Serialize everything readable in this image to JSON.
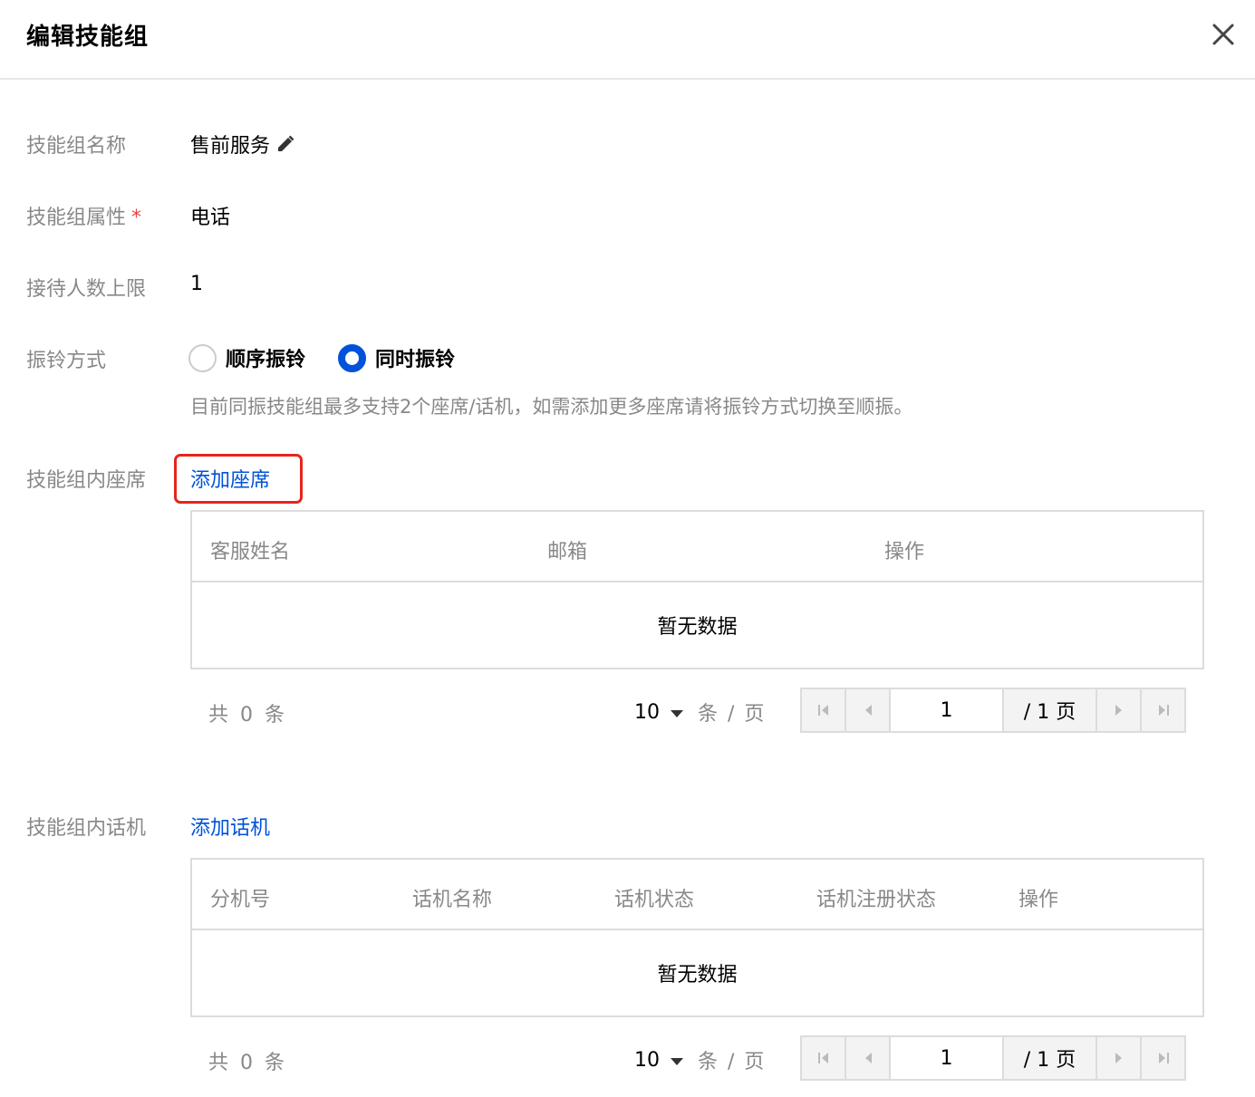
{
  "dialog": {
    "title": "编辑技能组"
  },
  "form": {
    "name_label": "技能组名称",
    "name_value": "售前服务",
    "attr_label": "技能组属性",
    "required_mark": "*",
    "attr_value": "电话",
    "limit_label": "接待人数上限",
    "limit_value": "1",
    "ring_label": "振铃方式",
    "ring_options": [
      {
        "label": "顺序振铃",
        "checked": false
      },
      {
        "label": "同时振铃",
        "checked": true
      }
    ],
    "ring_hint": "目前同振技能组最多支持2个座席/话机，如需添加更多座席请将振铃方式切换至顺振。"
  },
  "seats": {
    "label": "技能组内座席",
    "add_link": "添加座席",
    "columns": [
      "客服姓名",
      "邮箱",
      "操作"
    ],
    "empty_text": "暂无数据",
    "total_text": "共 0 条",
    "page_size": "10",
    "per_page_text": "条 / 页",
    "current_page": "1",
    "total_pages_text": "/ 1 页"
  },
  "phones": {
    "label": "技能组内话机",
    "add_link": "添加话机",
    "columns": [
      "分机号",
      "话机名称",
      "话机状态",
      "话机注册状态",
      "操作"
    ],
    "empty_text": "暂无数据",
    "total_text": "共 0 条",
    "page_size": "10",
    "per_page_text": "条 / 页",
    "current_page": "1",
    "total_pages_text": "/ 1 页"
  },
  "colors": {
    "accent": "#0052d9",
    "highlight": "#e5251c",
    "muted": "#888888"
  }
}
